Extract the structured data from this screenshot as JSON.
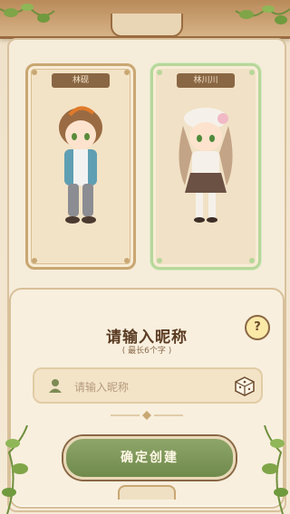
{
  "characters": [
    {
      "name": "林砚",
      "selected": false
    },
    {
      "name": "林川川",
      "selected": true
    }
  ],
  "nickname_panel": {
    "title": "请输入昵称",
    "subtitle": "( 最长6个字 )",
    "help_symbol": "?",
    "input_placeholder": "请输入昵称",
    "input_value": "",
    "confirm_label": "确定创建"
  },
  "colors": {
    "accent_green": "#7d9858",
    "wood": "#9a6c40",
    "selected_border": "#b7d79a"
  },
  "icons": [
    "user-icon",
    "dice-icon",
    "help-icon",
    "vine-decoration"
  ]
}
